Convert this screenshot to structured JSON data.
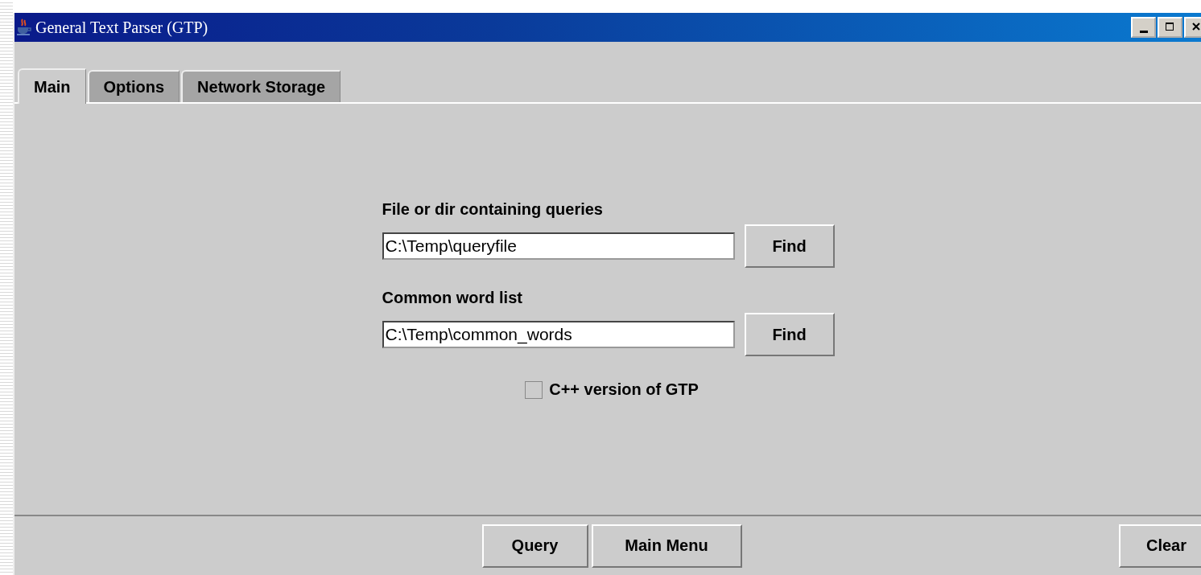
{
  "window": {
    "title": "General Text Parser (GTP)"
  },
  "tabs": [
    {
      "label": "Main",
      "selected": true
    },
    {
      "label": "Options",
      "selected": false
    },
    {
      "label": "Network Storage",
      "selected": false
    }
  ],
  "fields": [
    {
      "label": "File or dir containing queries",
      "value": "C:\\Temp\\queryfile",
      "button": "Find"
    },
    {
      "label": "Common word list",
      "value": "C:\\Temp\\common_words",
      "button": "Find"
    }
  ],
  "checkbox": {
    "label": "C++ version of GTP",
    "checked": false
  },
  "bottom_buttons": [
    "Query",
    "Main Menu"
  ],
  "clear_button": "Clear"
}
